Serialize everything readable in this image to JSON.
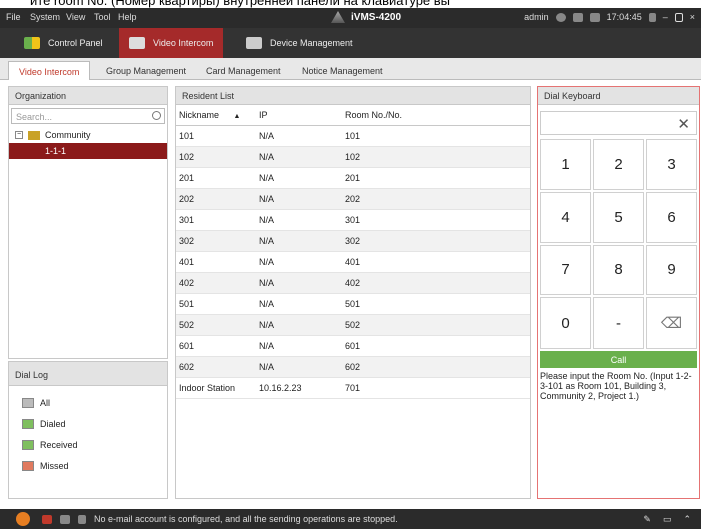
{
  "caption_overflow": "ите room No. (Номер квартиры) внутренней панели на клавиатуре вы",
  "menubar": {
    "items": [
      "File",
      "System",
      "View",
      "Tool",
      "Help"
    ],
    "app_title": "iVMS-4200",
    "user": "admin",
    "time": "17:04:45"
  },
  "modules": [
    {
      "label": "Control Panel",
      "active": false
    },
    {
      "label": "Video Intercom",
      "active": true
    },
    {
      "label": "Device Management",
      "active": false
    }
  ],
  "subtabs": [
    {
      "label": "Video Intercom",
      "active": true
    },
    {
      "label": "Group Management",
      "active": false
    },
    {
      "label": "Card Management",
      "active": false
    },
    {
      "label": "Notice Management",
      "active": false
    }
  ],
  "organization": {
    "title": "Organization",
    "search_placeholder": "Search...",
    "root": "Community",
    "selected": "1-1-1"
  },
  "dial_log": {
    "title": "Dial Log",
    "items": [
      "All",
      "Dialed",
      "Received",
      "Missed"
    ]
  },
  "resident_list": {
    "title": "Resident List",
    "columns": [
      "Nickname",
      "IP",
      "Room No./No."
    ],
    "rows": [
      [
        "101",
        "N/A",
        "101"
      ],
      [
        "102",
        "N/A",
        "102"
      ],
      [
        "201",
        "N/A",
        "201"
      ],
      [
        "202",
        "N/A",
        "202"
      ],
      [
        "301",
        "N/A",
        "301"
      ],
      [
        "302",
        "N/A",
        "302"
      ],
      [
        "401",
        "N/A",
        "401"
      ],
      [
        "402",
        "N/A",
        "402"
      ],
      [
        "501",
        "N/A",
        "501"
      ],
      [
        "502",
        "N/A",
        "502"
      ],
      [
        "601",
        "N/A",
        "601"
      ],
      [
        "602",
        "N/A",
        "602"
      ],
      [
        "Indoor Station",
        "10.16.2.23",
        "701"
      ]
    ]
  },
  "dial_keyboard": {
    "title": "Dial Keyboard",
    "keys": [
      "1",
      "2",
      "3",
      "4",
      "5",
      "6",
      "7",
      "8",
      "9",
      "0",
      "-",
      "⌫"
    ],
    "call_label": "Call",
    "hint": "Please input the Room No. (Input 1-2-3-101 as Room 101, Building 3, Community 2, Project 1.)"
  },
  "status": {
    "message": "No e-mail account is configured, and all the sending operations are stopped."
  },
  "colors": {
    "accent": "#a52a2a",
    "call": "#6ab04c",
    "dark_bar": "#2b2b2b"
  }
}
